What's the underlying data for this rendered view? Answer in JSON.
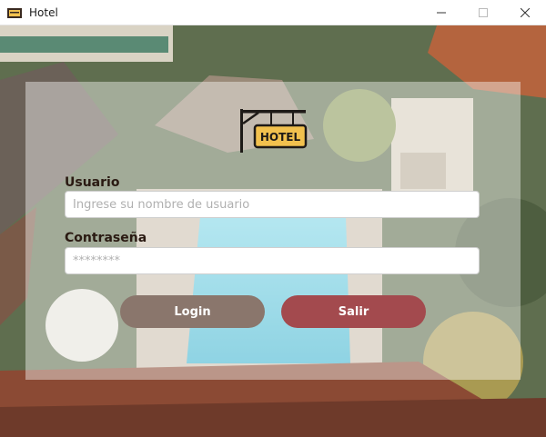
{
  "window": {
    "title": "Hotel"
  },
  "logo": {
    "sign_text": "HOTEL",
    "icon": "hotel-sign-icon"
  },
  "form": {
    "username_label": "Usuario",
    "username_placeholder": "Ingrese su nombre de usuario",
    "password_label": "Contraseña",
    "password_value": "********"
  },
  "buttons": {
    "login_label": "Login",
    "exit_label": "Salir"
  },
  "colors": {
    "login_button": "#8a766c",
    "exit_button": "#a34a4e"
  }
}
